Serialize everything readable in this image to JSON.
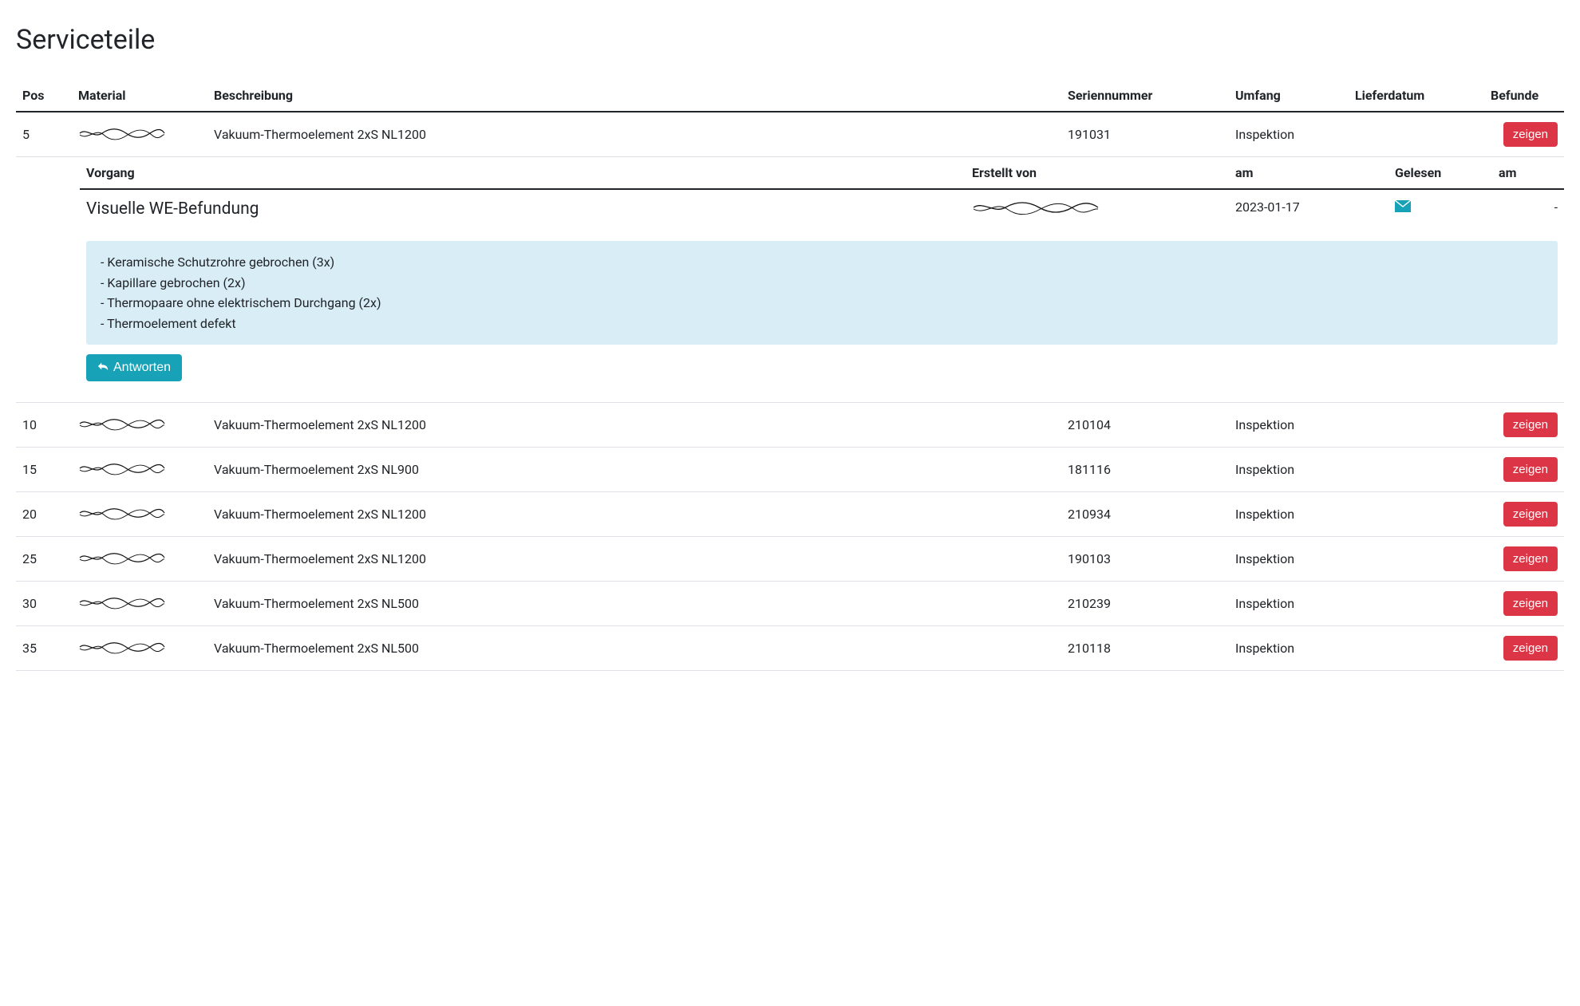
{
  "title": "Serviceteile",
  "columns": {
    "pos": "Pos",
    "material": "Material",
    "beschreibung": "Beschreibung",
    "seriennummer": "Seriennummer",
    "umfang": "Umfang",
    "lieferdatum": "Lieferdatum",
    "befunde": "Befunde"
  },
  "detail_columns": {
    "vorgang": "Vorgang",
    "erstellt_von": "Erstellt von",
    "am": "am",
    "gelesen": "Gelesen",
    "am2": "am"
  },
  "button_labels": {
    "show": "zeigen",
    "reply": "Antworten"
  },
  "rows": [
    {
      "pos": "5",
      "beschreibung": "Vakuum-Thermoelement 2xS NL1200",
      "seriennummer": "191031",
      "umfang": "Inspektion",
      "lieferdatum": ""
    },
    {
      "pos": "10",
      "beschreibung": "Vakuum-Thermoelement 2xS NL1200",
      "seriennummer": "210104",
      "umfang": "Inspektion",
      "lieferdatum": ""
    },
    {
      "pos": "15",
      "beschreibung": "Vakuum-Thermoelement 2xS NL900",
      "seriennummer": "181116",
      "umfang": "Inspektion",
      "lieferdatum": ""
    },
    {
      "pos": "20",
      "beschreibung": "Vakuum-Thermoelement 2xS NL1200",
      "seriennummer": "210934",
      "umfang": "Inspektion",
      "lieferdatum": ""
    },
    {
      "pos": "25",
      "beschreibung": "Vakuum-Thermoelement 2xS NL1200",
      "seriennummer": "190103",
      "umfang": "Inspektion",
      "lieferdatum": ""
    },
    {
      "pos": "30",
      "beschreibung": "Vakuum-Thermoelement 2xS NL500",
      "seriennummer": "210239",
      "umfang": "Inspektion",
      "lieferdatum": ""
    },
    {
      "pos": "35",
      "beschreibung": "Vakuum-Thermoelement 2xS NL500",
      "seriennummer": "210118",
      "umfang": "Inspektion",
      "lieferdatum": ""
    }
  ],
  "detail": {
    "vorgang": "Visuelle WE-Befundung",
    "am": "2023-01-17",
    "am2": "-",
    "notes": [
      "- Keramische Schutzrohre gebrochen (3x)",
      "- Kapillare gebrochen (2x)",
      "- Thermopaare ohne elektrischem Durchgang (2x)",
      "- Thermoelement defekt"
    ]
  }
}
